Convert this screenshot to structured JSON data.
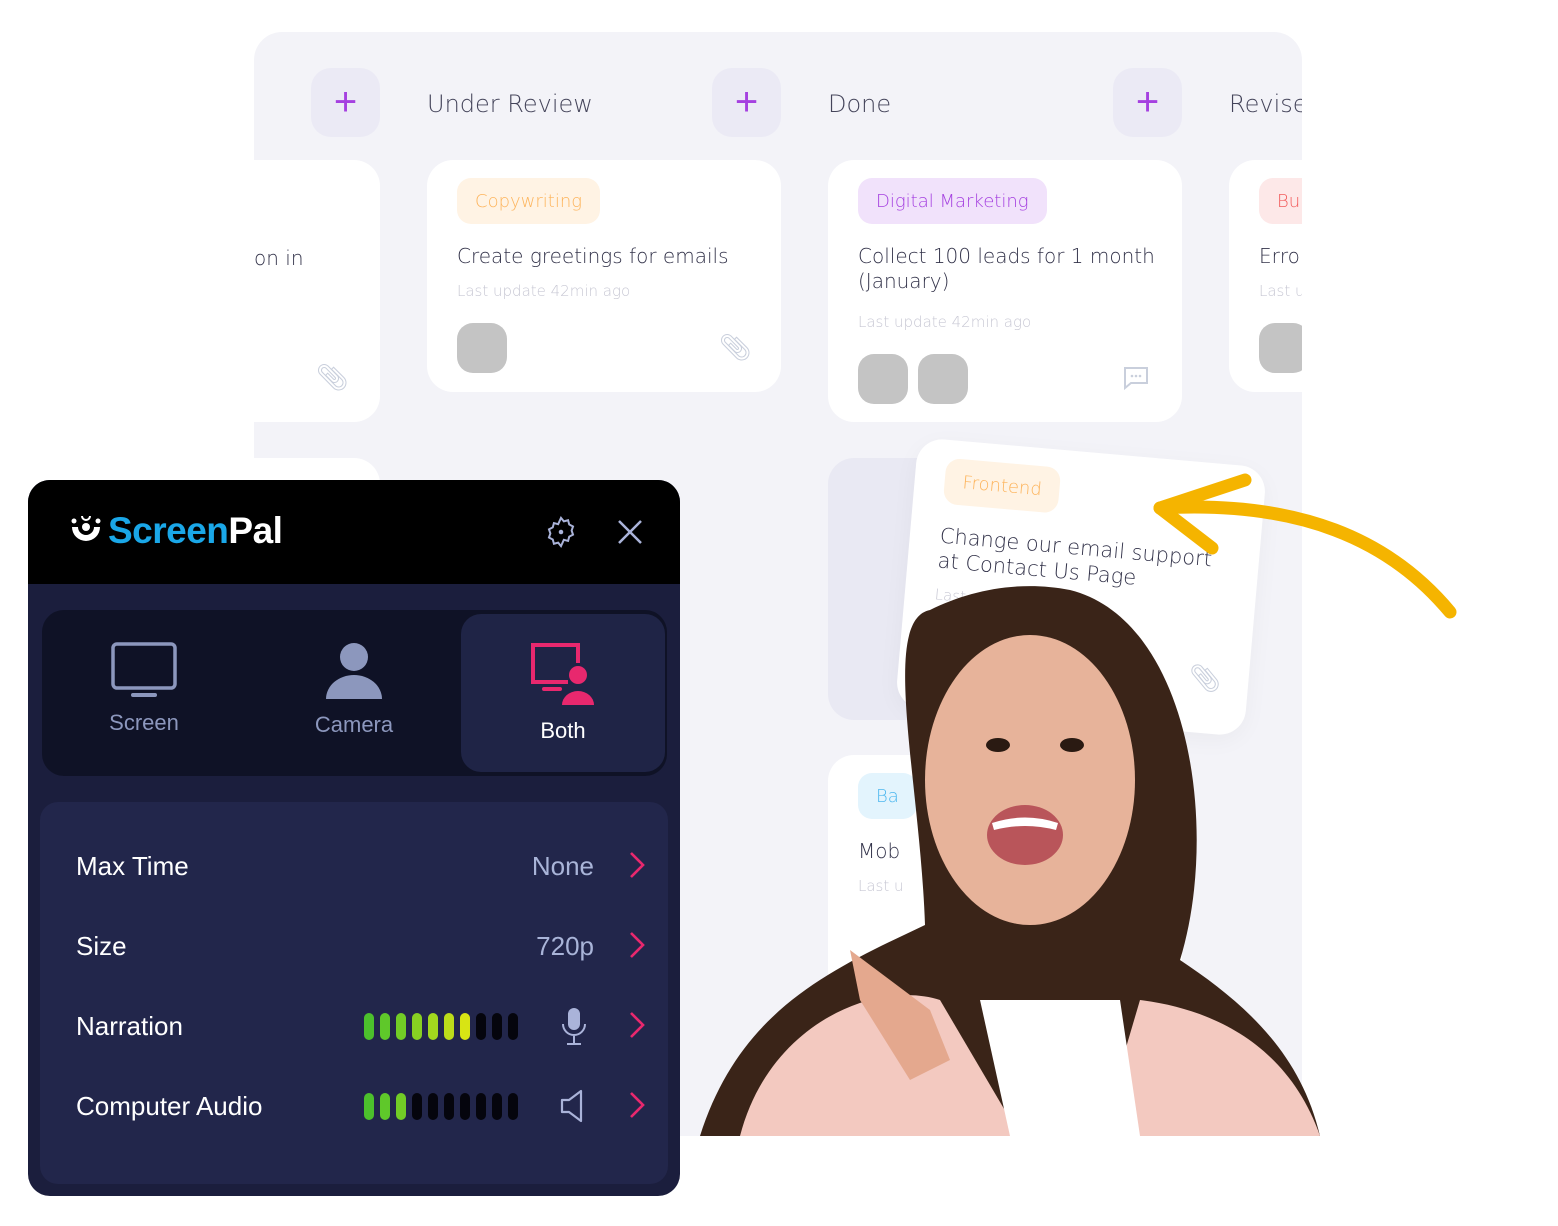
{
  "board": {
    "columns": [
      {
        "title": "Under Review"
      },
      {
        "title": "Done"
      },
      {
        "title": "Revise"
      }
    ],
    "add_icon": "plus-icon",
    "cards": {
      "partial_left": {
        "title": "on in"
      },
      "copywriting": {
        "tag": "Copywriting",
        "tag_color": "#fdb45c",
        "tag_bg": "#fff3e4",
        "title": "Create greetings for emails",
        "meta": "Last update 42min ago"
      },
      "digital_marketing": {
        "tag": "Digital Marketing",
        "tag_color": "#a540e0",
        "tag_bg": "#f1e2fb",
        "title": "Collect 100 leads for 1 month (January)",
        "meta": "Last update 42min ago"
      },
      "partial_right": {
        "tag": "Bu",
        "tag_color": "#f25c5c",
        "tag_bg": "#fde8e8",
        "title": "Error",
        "meta": "Last u"
      },
      "frontend": {
        "tag": "Frontend",
        "tag_color": "#fdb45c",
        "tag_bg": "#fff3e4",
        "title": "Change our email support at Contact Us Page",
        "meta": "Last up"
      },
      "lower": {
        "tag": "Ba",
        "tag_color": "#4fb8ef",
        "tag_bg": "#e3f4fd",
        "title": "Mob",
        "meta": "Last u"
      }
    }
  },
  "widget": {
    "brand": {
      "part1": "Screen",
      "part2": "Pal",
      "color": "#1aa7e8"
    },
    "settings_icon": "gear-icon",
    "close_icon": "close-icon",
    "modes": [
      {
        "label": "Screen",
        "icon": "monitor-icon",
        "selected": false
      },
      {
        "label": "Camera",
        "icon": "person-icon",
        "selected": false
      },
      {
        "label": "Both",
        "icon": "monitor-person-icon",
        "selected": true
      }
    ],
    "accent": "#e8286e",
    "options": {
      "max_time": {
        "label": "Max Time",
        "value": "None"
      },
      "size": {
        "label": "Size",
        "value": "720p"
      },
      "narration": {
        "label": "Narration",
        "level": 7,
        "segments": 10,
        "icon": "microphone-icon"
      },
      "computer_audio": {
        "label": "Computer Audio",
        "level": 3,
        "segments": 10,
        "icon": "speaker-icon"
      }
    }
  },
  "arrow_color": "#f5b400"
}
